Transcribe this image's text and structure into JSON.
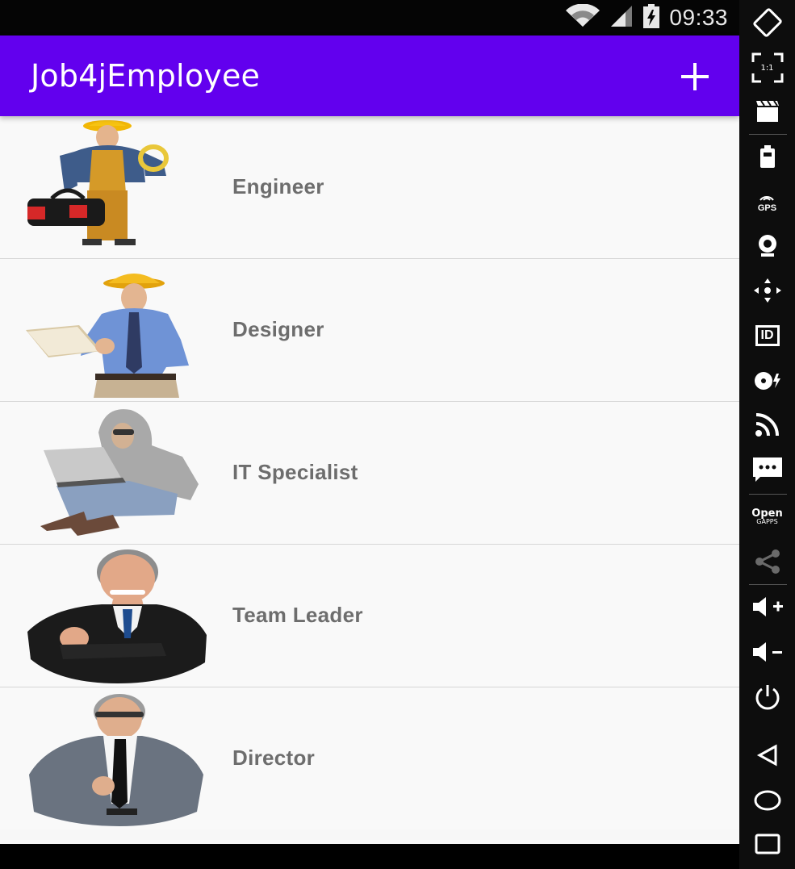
{
  "status_bar": {
    "time": "09:33"
  },
  "app_bar": {
    "title": "Job4jEmployee",
    "add_icon": "plus-icon"
  },
  "employees": [
    {
      "label": "Engineer",
      "avatar": "engineer-photo"
    },
    {
      "label": "Designer",
      "avatar": "designer-photo"
    },
    {
      "label": "IT Specialist",
      "avatar": "it-specialist-photo"
    },
    {
      "label": "Team Leader",
      "avatar": "team-leader-photo"
    },
    {
      "label": "Director",
      "avatar": "director-photo"
    }
  ],
  "emulator_panel": {
    "gps_label": "GPS",
    "aspect_label": "1:1",
    "id_label": "ID",
    "opengapps_line1": "Open",
    "opengapps_line2": "GAPPS"
  },
  "colors": {
    "app_bar": "#6200ee",
    "status_bar": "#050505",
    "label_text": "#6d6d6d"
  }
}
